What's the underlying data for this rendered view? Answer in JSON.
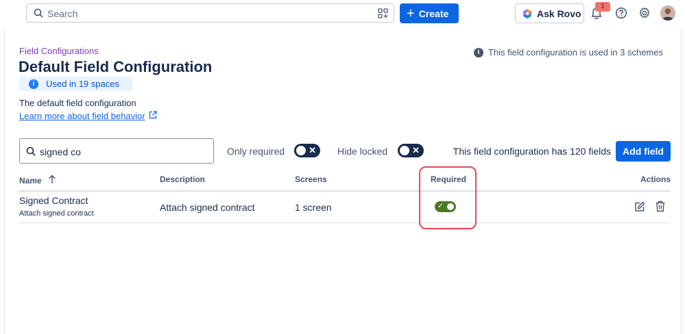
{
  "topbar": {
    "search_placeholder": "Search",
    "create_label": "Create",
    "ask_rovo_label": "Ask Rovo",
    "notification_count": "1"
  },
  "header": {
    "breadcrumb": "Field Configurations",
    "title": "Default Field Configuration",
    "used_in": "Used in 19 spaces",
    "schemes_note": "This field configuration is used in 3 schemes",
    "description": "The default field configuration",
    "learn_more": "Learn more about field behavior"
  },
  "filters": {
    "search_value": "signed co",
    "only_required_label": "Only required",
    "hide_locked_label": "Hide locked",
    "field_count_text": "This field configuration has 120 fields",
    "add_field_label": "Add field"
  },
  "table": {
    "columns": {
      "name": "Name",
      "description": "Description",
      "screens": "Screens",
      "required": "Required",
      "actions": "Actions"
    },
    "rows": [
      {
        "name": "Signed Contract",
        "name_sub": "Attach signed contract",
        "description": "Attach signed contract",
        "screens": "1 screen",
        "required": true
      }
    ]
  },
  "colors": {
    "accent": "#0c66e4",
    "breadcrumb": "#7b3cb0",
    "toggle_on": "#4a7a23",
    "highlight": "#e5484d"
  }
}
